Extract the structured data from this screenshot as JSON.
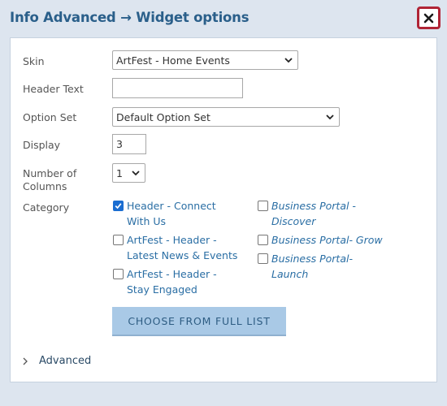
{
  "dialog": {
    "title": "Info Advanced → Widget options"
  },
  "form": {
    "skin": {
      "label": "Skin",
      "value": "ArtFest - Home Events"
    },
    "header_text": {
      "label": "Header Text",
      "value": ""
    },
    "option_set": {
      "label": "Option Set",
      "value": "Default Option Set"
    },
    "display": {
      "label": "Display",
      "value": "3"
    },
    "columns": {
      "label": "Number of\nColumns",
      "value": "1"
    },
    "category": {
      "label": "Category",
      "items": [
        {
          "label": "Header - Connect\nWith Us",
          "checked": true
        },
        {
          "label": "ArtFest - Header -\nLatest News & Events",
          "checked": false
        },
        {
          "label": "ArtFest - Header -\nStay Engaged",
          "checked": false
        },
        {
          "label": "Business Portal -\nDiscover",
          "checked": false
        },
        {
          "label": "Business Portal- Grow",
          "checked": false
        },
        {
          "label": "Business Portal-\nLaunch",
          "checked": false
        }
      ]
    },
    "full_list_button": "CHOOSE FROM FULL LIST",
    "advanced_label": "Advanced"
  },
  "colors": {
    "title": "#2a5f8a",
    "close_border": "#b02436",
    "link": "#2a6ea4",
    "button_bg": "#a9c9e6",
    "checkbox": "#1a6dd1"
  },
  "icons": [
    "close-icon",
    "dropdown-caret-icon",
    "checkmark-icon",
    "chevron-right-icon"
  ]
}
